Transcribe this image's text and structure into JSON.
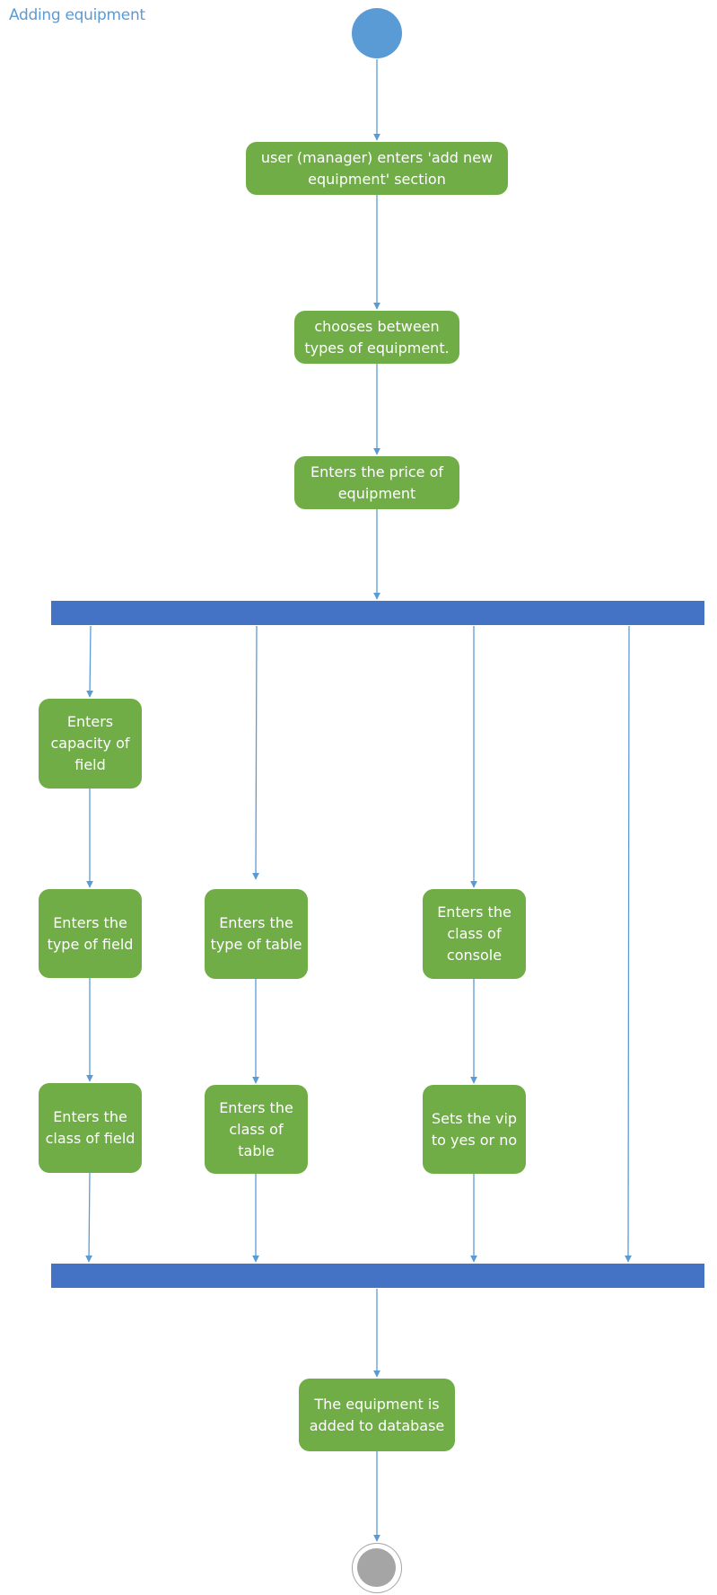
{
  "title": "Adding equipment",
  "colors": {
    "title": "#5b9bd5",
    "start_node": "#5b9bd5",
    "action_node": "#70ad47",
    "sync_bar": "#4472c4",
    "connector": "#5b9bd5",
    "end_node": "#a5a5a5"
  },
  "nodes": {
    "start": {
      "type": "initial",
      "label": ""
    },
    "enter_section": {
      "type": "action",
      "label": "user (manager) enters 'add new equipment' section"
    },
    "choose_type": {
      "type": "action",
      "label": "chooses between types of equipment."
    },
    "enter_price": {
      "type": "action",
      "label": "Enters the price of equipment"
    },
    "fork": {
      "type": "fork",
      "label": ""
    },
    "field_capacity": {
      "type": "action",
      "label": "Enters capacity of field"
    },
    "field_type": {
      "type": "action",
      "label": "Enters the type of field"
    },
    "field_class": {
      "type": "action",
      "label": "Enters the class of field"
    },
    "table_type": {
      "type": "action",
      "label": "Enters the type of table"
    },
    "table_class": {
      "type": "action",
      "label": "Enters the class of table"
    },
    "console_class": {
      "type": "action",
      "label": "Enters the class of console"
    },
    "console_vip": {
      "type": "action",
      "label": "Sets the vip to yes or no"
    },
    "join": {
      "type": "join",
      "label": ""
    },
    "added": {
      "type": "action",
      "label": "The equipment is added to database"
    },
    "end": {
      "type": "final",
      "label": ""
    }
  },
  "edges": [
    [
      "start",
      "enter_section"
    ],
    [
      "enter_section",
      "choose_type"
    ],
    [
      "choose_type",
      "enter_price"
    ],
    [
      "enter_price",
      "fork"
    ],
    [
      "fork",
      "field_capacity"
    ],
    [
      "field_capacity",
      "field_type"
    ],
    [
      "field_type",
      "field_class"
    ],
    [
      "field_class",
      "join"
    ],
    [
      "fork",
      "table_type"
    ],
    [
      "table_type",
      "table_class"
    ],
    [
      "table_class",
      "join"
    ],
    [
      "fork",
      "console_class"
    ],
    [
      "console_class",
      "console_vip"
    ],
    [
      "console_vip",
      "join"
    ],
    [
      "fork",
      "join"
    ],
    [
      "join",
      "added"
    ],
    [
      "added",
      "end"
    ]
  ]
}
